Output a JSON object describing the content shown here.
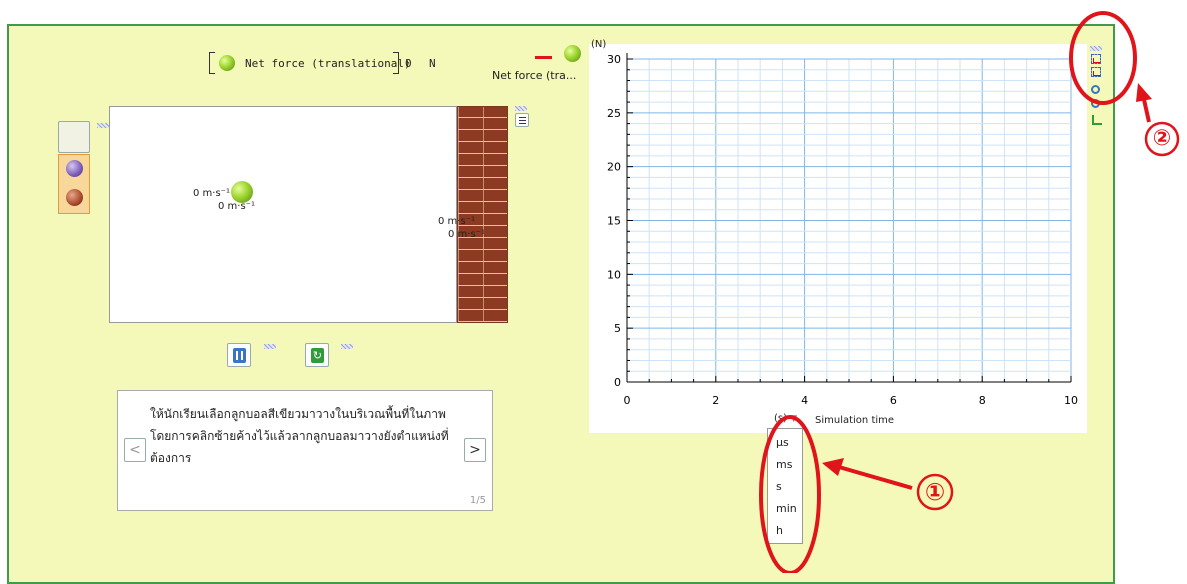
{
  "header": {
    "net_force_label": "Net force (translational)",
    "net_force_value": "0",
    "net_force_unit": "N",
    "legend_label": "Net force (tra..."
  },
  "sim": {
    "vel_labels": [
      "0 m·s⁻¹",
      "0 m·s⁻¹",
      "0 m·s⁻¹",
      "0 m·s⁻¹"
    ]
  },
  "info": {
    "text": "ให้นักเรียนเลือกลูกบอลสีเขียวมาวางในบริเวณพื้นที่ในภาพ โดยการคลิกซ้ายค้างไว้แล้วลากลูกบอลมาวางยังตำแหน่งที่ต้องการ",
    "page": "1/5",
    "prev_glyph": "<",
    "next_glyph": ">"
  },
  "chart_data": {
    "type": "line",
    "ylabel": "(N)",
    "xlabel": "Simulation time",
    "xunit": "(s)",
    "xlim": [
      0,
      10
    ],
    "ylim": [
      0,
      30
    ],
    "xticks": [
      "0",
      "2",
      "4",
      "6",
      "8",
      "10"
    ],
    "yticks": [
      "0",
      "5",
      "10",
      "15",
      "20",
      "25",
      "30"
    ],
    "grid": true,
    "series": []
  },
  "unit_menu": {
    "options": [
      "μs",
      "ms",
      "s",
      "min",
      "h"
    ]
  },
  "annotations": {
    "marker1": "①",
    "marker2": "②"
  },
  "colors": {
    "stage_bg": "#f4f8b8",
    "border": "#3f9a4a",
    "annot_red": "#e0141b",
    "grid_blue": "#7fb6e6"
  }
}
